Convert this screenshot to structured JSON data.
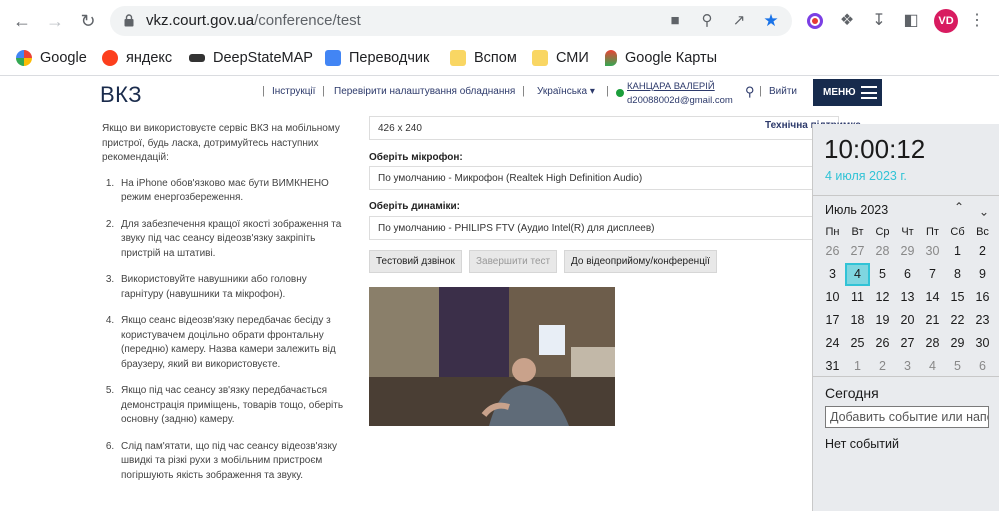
{
  "browser": {
    "url_host": "vkz.court.gov.ua",
    "url_path": "/conference/test",
    "avatar_initials": "VD",
    "bookmarks": [
      {
        "label": "Google",
        "icon": "google-icon"
      },
      {
        "label": "яндекс",
        "icon": "yandex-icon"
      },
      {
        "label": "DeepStateMAP",
        "icon": "deepstate-icon"
      },
      {
        "label": "Переводчик",
        "icon": "translate-icon"
      },
      {
        "label": "Вспом",
        "icon": "folder-icon"
      },
      {
        "label": "СМИ",
        "icon": "folder-icon"
      },
      {
        "label": "Google Карты",
        "icon": "maps-icon"
      }
    ]
  },
  "site": {
    "logo": "ВКЗ",
    "nav": {
      "instructions": "Інструкції",
      "check_equipment": "Перевірити налаштування обладнання",
      "language": "Українська"
    },
    "user": {
      "name": "КАНЦАРА ВАЛЕРІЙ",
      "email": "d20088002d@gmail.com"
    },
    "logout": "Вийти",
    "menu": "МЕНЮ",
    "tech_support": "Технічна підтримка"
  },
  "instructions": {
    "intro": "Якщо ви використовуєте сервіс ВКЗ на мобільному пристрої, будь ласка, дотримуйтесь наступних рекомендацій:",
    "items": [
      "На iPhone обов'язково має бути ВИМКНЕНО режим енергозбереження.",
      "Для забезпечення кращої якості зображення та звуку під час сеансу відеозв'язку закріпіть пристрій на штативі.",
      "Використовуйте навушники або головну гарнітуру (навушники та мікрофон).",
      "Якщо сеанс відеозв'язку передбачає бесіду з користувачем доцільно обрати фронтальну (передню) камеру. Назва камери залежить від браузеру, який ви використовуєте.",
      "Якщо під час сеансу зв'язку передбачається демонстрація приміщень, товарів тощо, оберіть основну (задню) камеру.",
      "Слід пам'ятати, що під час сеансу відеозв'язку швидкі та різкі рухи з мобільним пристроєм погіршують якість зображення та звуку."
    ]
  },
  "form": {
    "resolution_value": "426 x 240",
    "mic_label": "Оберіть мікрофон:",
    "mic_value": "По умолчанию - Микрофон (Realtek High Definition Audio)",
    "speaker_label": "Оберіть динаміки:",
    "speaker_value": "По умолчанию - PHILIPS FTV (Аудио Intel(R) для дисплеев)",
    "test_call": "Тестовий дзвінок",
    "finish_test": "Завершити тест",
    "to_reception": "До відеоприйому/конференції"
  },
  "clock": {
    "time": "10:00:12",
    "date": "4 июля 2023 г.",
    "month": "Июль 2023",
    "weekdays": [
      "Пн",
      "Вт",
      "Ср",
      "Чт",
      "Пт",
      "Сб",
      "Вс"
    ],
    "weeks": [
      [
        "26",
        "27",
        "28",
        "29",
        "30",
        "1",
        "2"
      ],
      [
        "3",
        "4",
        "5",
        "6",
        "7",
        "8",
        "9"
      ],
      [
        "10",
        "11",
        "12",
        "13",
        "14",
        "15",
        "16"
      ],
      [
        "17",
        "18",
        "19",
        "20",
        "21",
        "22",
        "23"
      ],
      [
        "24",
        "25",
        "26",
        "27",
        "28",
        "29",
        "30"
      ],
      [
        "31",
        "1",
        "2",
        "3",
        "4",
        "5",
        "6"
      ]
    ],
    "today": "Сегодня",
    "event_placeholder": "Добавить событие или напоминание",
    "no_events": "Нет событий"
  }
}
